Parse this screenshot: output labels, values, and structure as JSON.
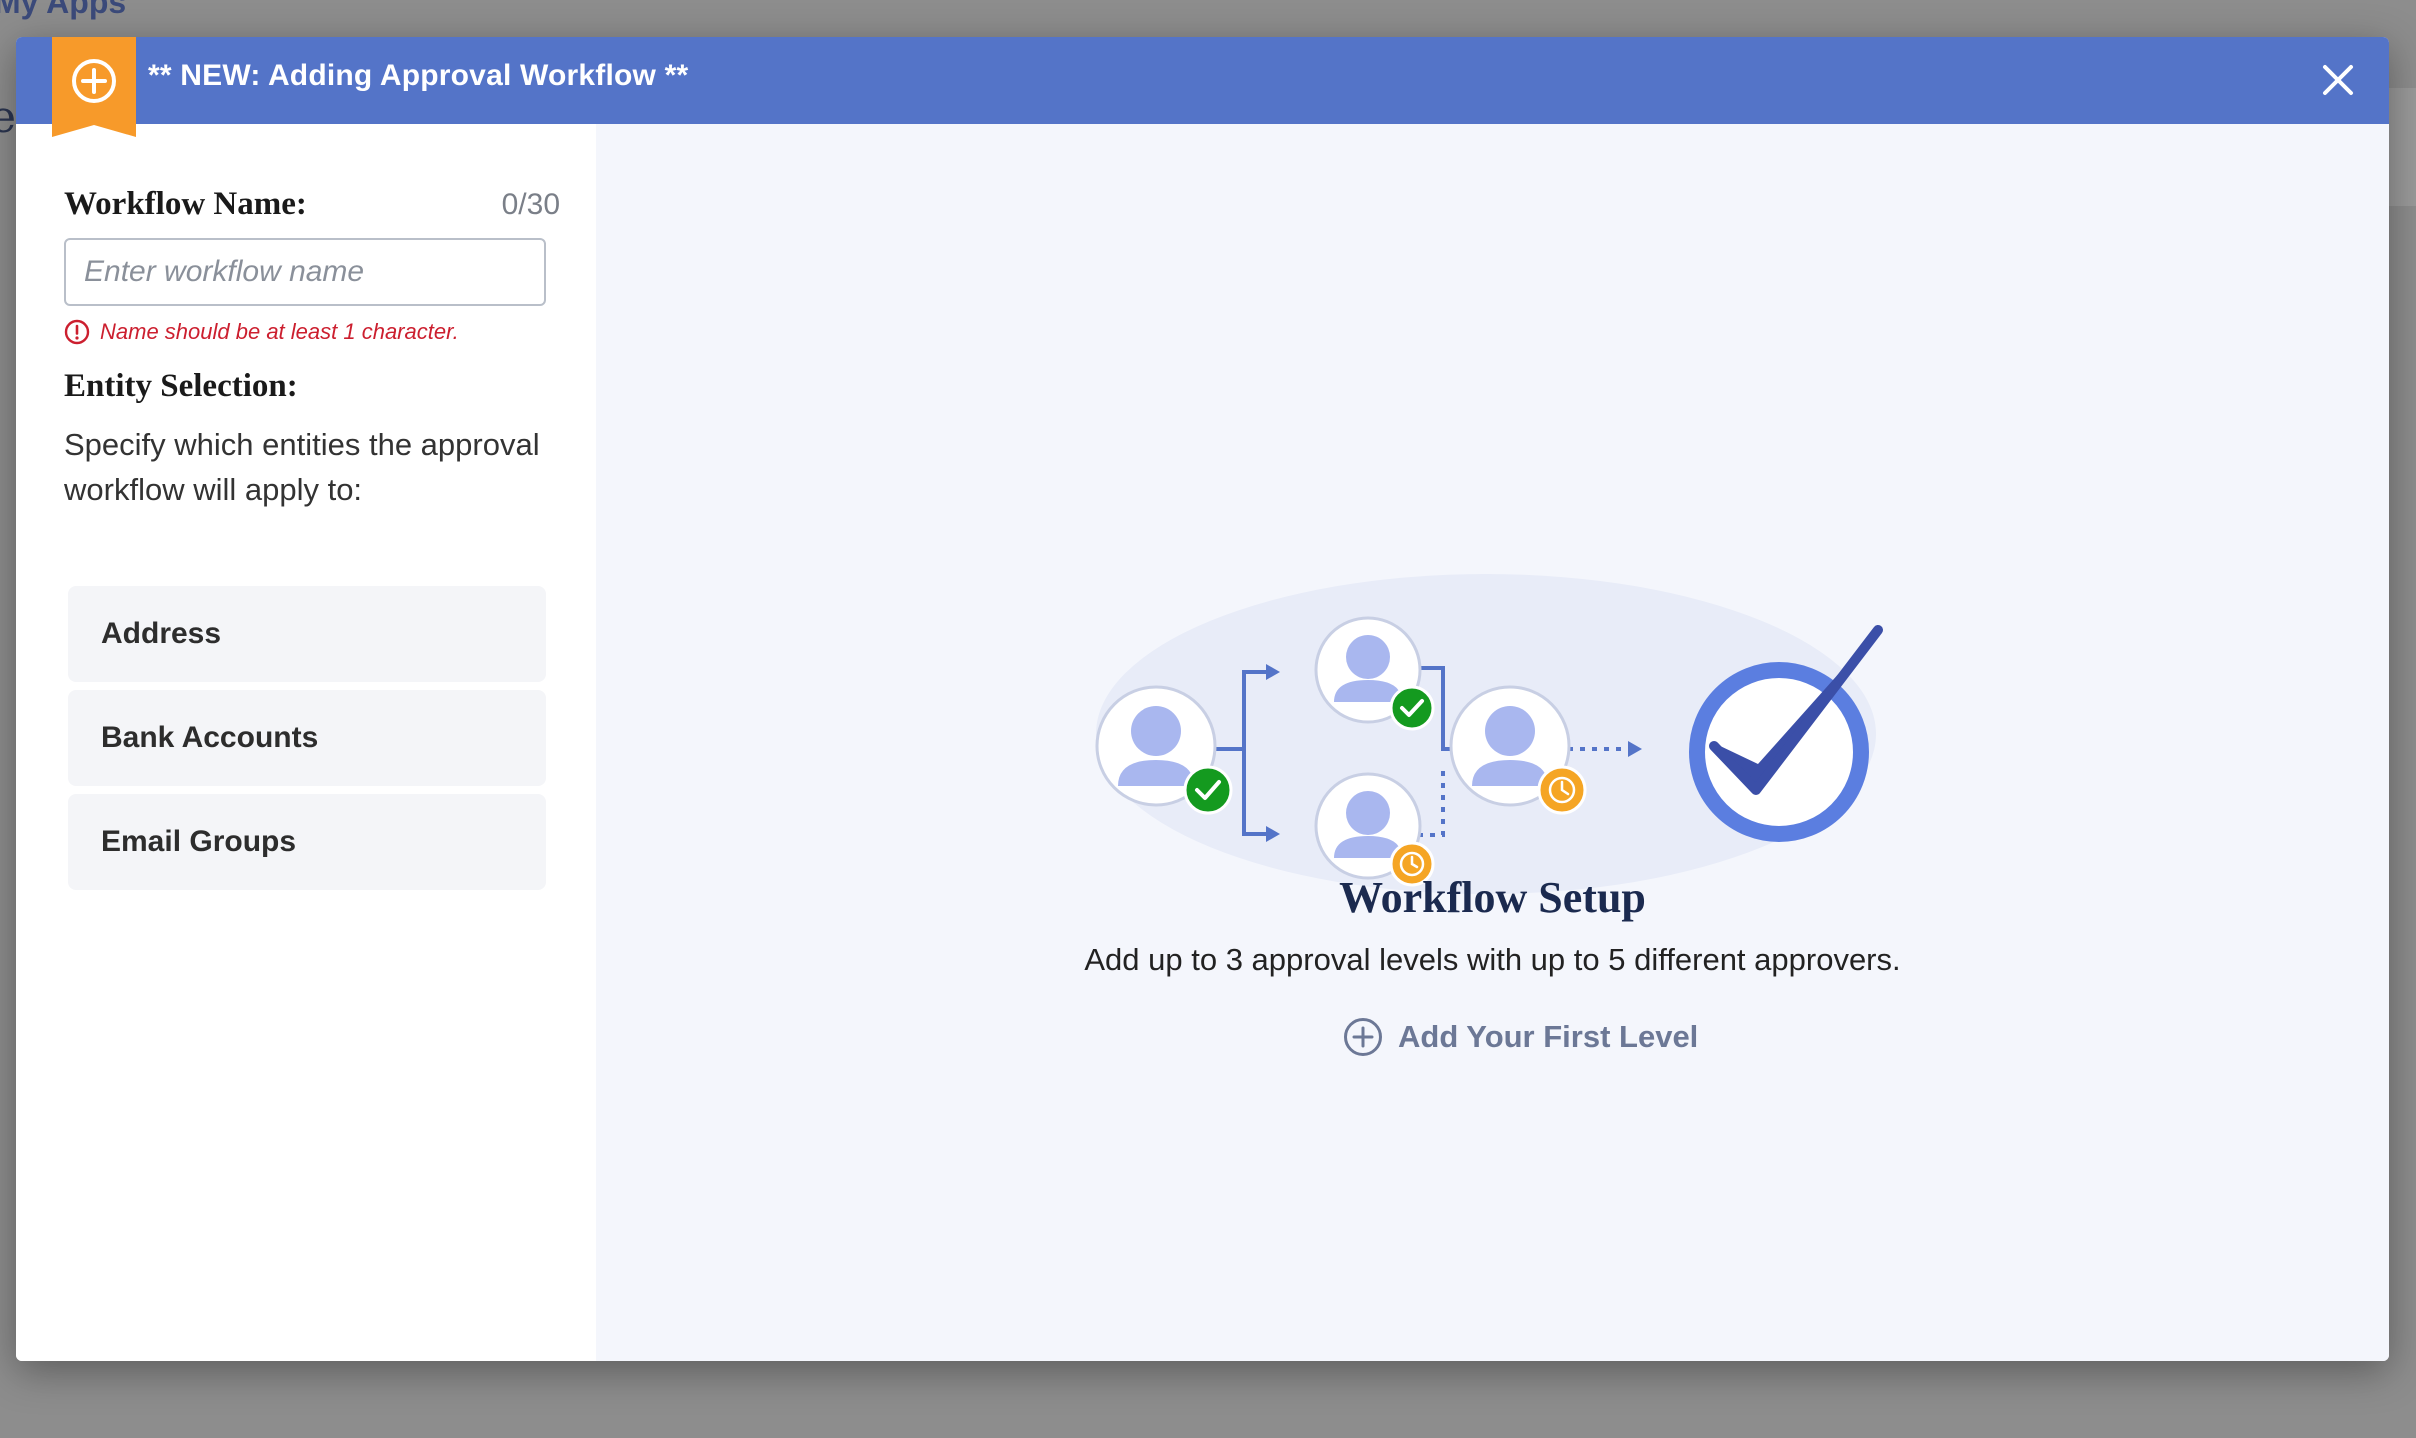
{
  "background": {
    "app_label": "My Apps",
    "partial_letter": "e"
  },
  "modal": {
    "title": "** NEW: Adding Approval Workflow **",
    "badge_icon": "plus-circle-icon",
    "close_icon": "close-icon",
    "colors": {
      "header": "#5474c8",
      "badge": "#f79a2a",
      "panel_bg": "#f4f6fc",
      "error": "#cc1f2f"
    }
  },
  "form": {
    "name_label": "Workflow Name:",
    "name_counter": "0/30",
    "name_placeholder": "Enter workflow name",
    "name_value": "",
    "name_error": "Name should be at least 1 character.",
    "entity_title": "Entity Selection:",
    "entity_description": "Specify which entities the approval workflow will apply to:",
    "entities": [
      {
        "label": "Address"
      },
      {
        "label": "Bank Accounts"
      },
      {
        "label": "Email Groups"
      }
    ]
  },
  "setup": {
    "title": "Workflow Setup",
    "description": "Add up to 3 approval levels with up to 5 different approvers.",
    "add_level_label": "Add Your First Level",
    "add_level_icon": "plus-circle-icon"
  }
}
